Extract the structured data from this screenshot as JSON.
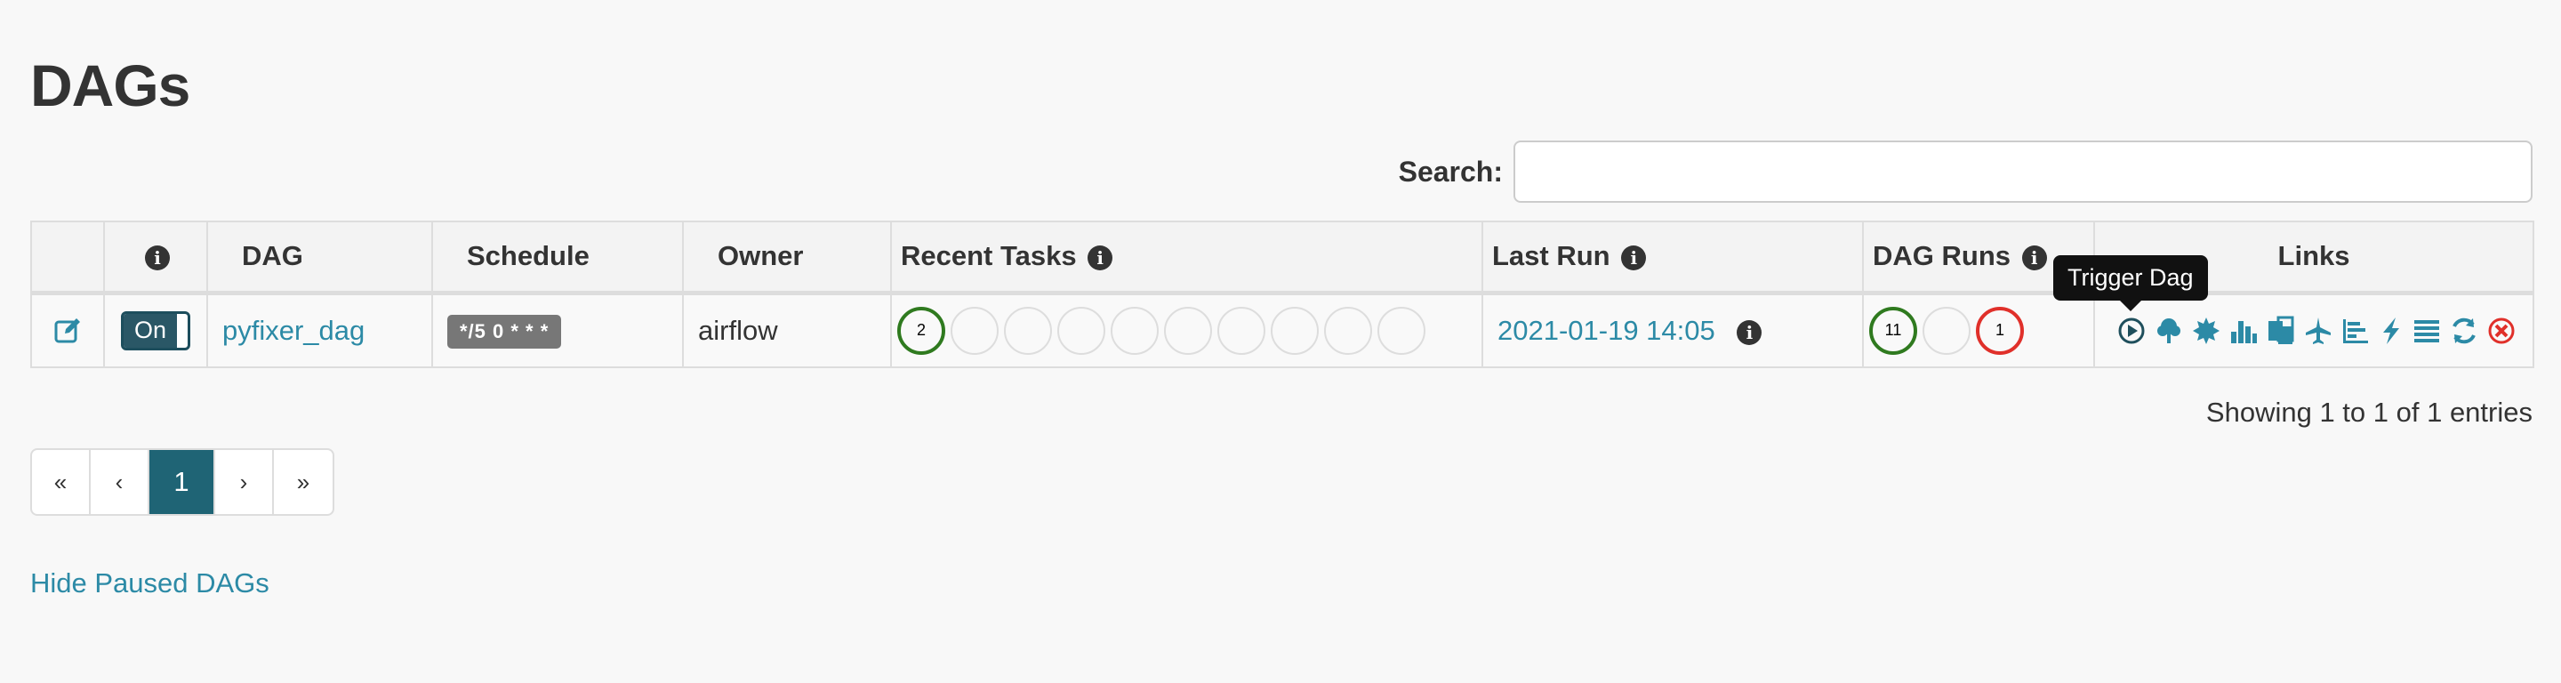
{
  "page": {
    "title": "DAGs"
  },
  "search": {
    "label": "Search:",
    "value": ""
  },
  "table": {
    "headers": {
      "dag": "DAG",
      "schedule": "Schedule",
      "owner": "Owner",
      "recent_tasks": "Recent Tasks",
      "last_run": "Last Run",
      "dag_runs": "DAG Runs",
      "links": "Links"
    },
    "rows": [
      {
        "toggle_label": "On",
        "dag_id": "pyfixer_dag",
        "schedule": "*/5 0 * * *",
        "owner": "airflow",
        "recent_tasks": [
          "2",
          "",
          "",
          "",
          "",
          "",
          "",
          "",
          "",
          ""
        ],
        "last_run": "2021-01-19 14:05",
        "dag_runs": [
          "11",
          "",
          "1"
        ]
      }
    ]
  },
  "tooltip": {
    "text": "Trigger Dag"
  },
  "links_icons": [
    "trigger-dag-icon",
    "tree-view-icon",
    "graph-view-icon",
    "task-duration-icon",
    "task-tries-icon",
    "landing-times-icon",
    "gantt-icon",
    "code-icon",
    "logs-icon",
    "refresh-icon",
    "delete-icon"
  ],
  "footer": {
    "entries_info": "Showing 1 to 1 of 1 entries",
    "pagination": [
      "«",
      "‹",
      "1",
      "›",
      "»"
    ],
    "hide_paused": "Hide Paused DAGs"
  },
  "colors": {
    "accent": "#2c8aa6",
    "success": "#2f7a1f",
    "failed": "#e0302a",
    "active_page": "#1f6475"
  }
}
